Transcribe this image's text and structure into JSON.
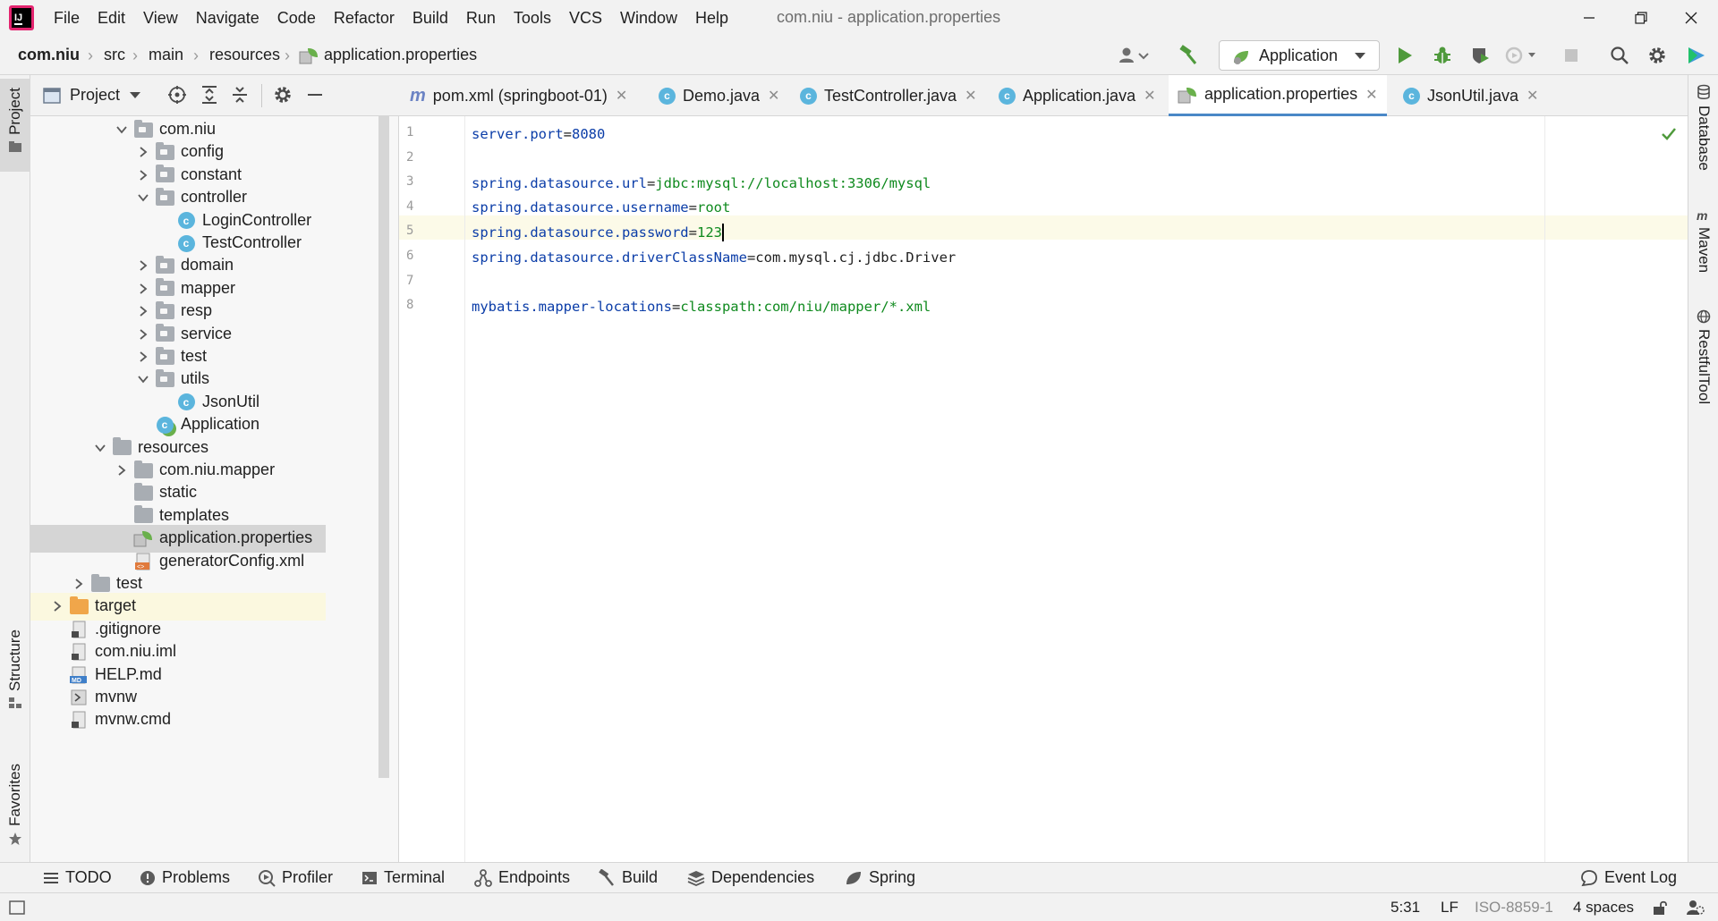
{
  "window": {
    "title": "com.niu - application.properties",
    "menu": [
      "File",
      "Edit",
      "View",
      "Navigate",
      "Code",
      "Refactor",
      "Build",
      "Run",
      "Tools",
      "VCS",
      "Window",
      "Help"
    ]
  },
  "breadcrumb": [
    "com.niu",
    "src",
    "main",
    "resources",
    "application.properties"
  ],
  "toolbar": {
    "run_config": "Application"
  },
  "left_strip": {
    "project": "Project",
    "structure": "Structure",
    "favorites": "Favorites"
  },
  "right_strip": {
    "database": "Database",
    "maven": "Maven",
    "restful": "RestfulTool"
  },
  "project_panel": {
    "title": "Project"
  },
  "tree": [
    {
      "label": "com.niu",
      "kind": "package",
      "expanded": true
    },
    {
      "label": "config",
      "kind": "package",
      "expanded": false
    },
    {
      "label": "constant",
      "kind": "package",
      "expanded": false
    },
    {
      "label": "controller",
      "kind": "package",
      "expanded": true
    },
    {
      "label": "LoginController",
      "kind": "class"
    },
    {
      "label": "TestController",
      "kind": "class"
    },
    {
      "label": "domain",
      "kind": "package",
      "expanded": false
    },
    {
      "label": "mapper",
      "kind": "package",
      "expanded": false
    },
    {
      "label": "resp",
      "kind": "package",
      "expanded": false
    },
    {
      "label": "service",
      "kind": "package",
      "expanded": false
    },
    {
      "label": "test",
      "kind": "package",
      "expanded": false
    },
    {
      "label": "utils",
      "kind": "package",
      "expanded": true
    },
    {
      "label": "JsonUtil",
      "kind": "class"
    },
    {
      "label": "Application",
      "kind": "spring-class"
    },
    {
      "label": "resources",
      "kind": "resources-folder",
      "expanded": true
    },
    {
      "label": "com.niu.mapper",
      "kind": "folder",
      "expanded": false
    },
    {
      "label": "static",
      "kind": "folder"
    },
    {
      "label": "templates",
      "kind": "folder"
    },
    {
      "label": "application.properties",
      "kind": "properties",
      "selected": true
    },
    {
      "label": "generatorConfig.xml",
      "kind": "xml"
    },
    {
      "label": "test",
      "kind": "folder",
      "expanded": false
    },
    {
      "label": "target",
      "kind": "excluded-folder",
      "expanded": false
    },
    {
      "label": ".gitignore",
      "kind": "file"
    },
    {
      "label": "com.niu.iml",
      "kind": "file"
    },
    {
      "label": "HELP.md",
      "kind": "markdown"
    },
    {
      "label": "mvnw",
      "kind": "script"
    },
    {
      "label": "mvnw.cmd",
      "kind": "file"
    }
  ],
  "tabs": [
    {
      "label": "pom.xml (springboot-01)",
      "icon": "maven-icon"
    },
    {
      "label": "Demo.java",
      "icon": "class-icon"
    },
    {
      "label": "TestController.java",
      "icon": "class-icon"
    },
    {
      "label": "Application.java",
      "icon": "spring-class-icon"
    },
    {
      "label": "application.properties",
      "icon": "properties-icon",
      "active": true
    },
    {
      "label": "JsonUtil.java",
      "icon": "class-icon"
    }
  ],
  "editor": {
    "line_numbers": [
      "1",
      "2",
      "3",
      "4",
      "5",
      "6",
      "7",
      "8"
    ],
    "lines": [
      {
        "key": "server.port",
        "value": "8080",
        "value_kind": "number"
      },
      {
        "key": "",
        "value": ""
      },
      {
        "key": "spring.datasource.url",
        "value": "jdbc:mysql://localhost:3306/mysql",
        "value_kind": "string"
      },
      {
        "key": "spring.datasource.username",
        "value": "root",
        "value_kind": "string"
      },
      {
        "key": "spring.datasource.password",
        "value": "123",
        "value_kind": "string"
      },
      {
        "key": "spring.datasource.driverClassName",
        "value": "com.mysql.cj.jdbc.Driver",
        "value_kind": "plain"
      },
      {
        "key": "",
        "value": ""
      },
      {
        "key": "mybatis.mapper-locations",
        "value": "classpath:com/niu/mapper/*.xml",
        "value_kind": "string"
      }
    ]
  },
  "bottom_tools": [
    "TODO",
    "Problems",
    "Profiler",
    "Terminal",
    "Endpoints",
    "Build",
    "Dependencies",
    "Spring",
    "Event Log"
  ],
  "status": {
    "position": "5:31",
    "line_sep": "LF",
    "encoding": "ISO-8859-1",
    "indent": "4 spaces"
  },
  "colors": {
    "key": "#0b3da8",
    "string_value": "#0f8a1e",
    "accent": "#4a88c7",
    "selection": "#d5d5d5"
  }
}
